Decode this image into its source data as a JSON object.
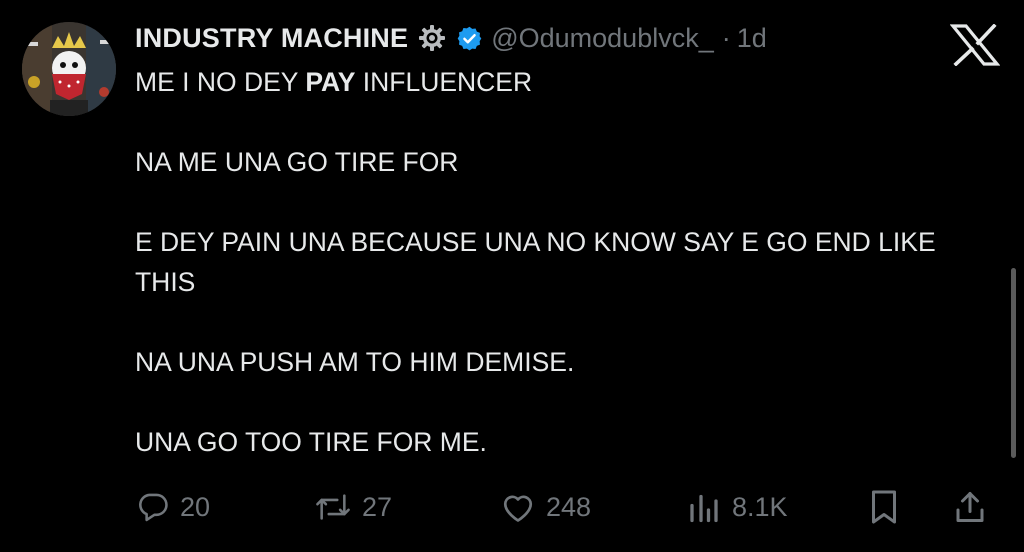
{
  "tweet": {
    "author": {
      "display_name": "INDUSTRY MACHINE",
      "handle": "@Odumodublvck_",
      "separator": "·",
      "time": "1d",
      "affiliation_icon": "gear-icon",
      "verified_icon": "verified-badge-icon"
    },
    "body": {
      "line1_before": "ME I NO DEY ",
      "line1_bold": "PAY",
      "line1_after": " INFLUENCER",
      "line2": "NA ME UNA GO TIRE FOR",
      "line3": "E DEY PAIN UNA BECAUSE UNA NO KNOW SAY E GO END LIKE THIS",
      "line4": "NA UNA PUSH AM TO HIM DEMISE.",
      "line5": "UNA GO TOO TIRE FOR ME."
    },
    "actions": {
      "replies": "20",
      "reposts": "27",
      "likes": "248",
      "views": "8.1K"
    }
  },
  "brand": {
    "logo": "x-logo",
    "accent": "#1d9bf0"
  },
  "colors": {
    "background": "#000000",
    "text": "#e7e9ea",
    "muted": "#71767b"
  }
}
